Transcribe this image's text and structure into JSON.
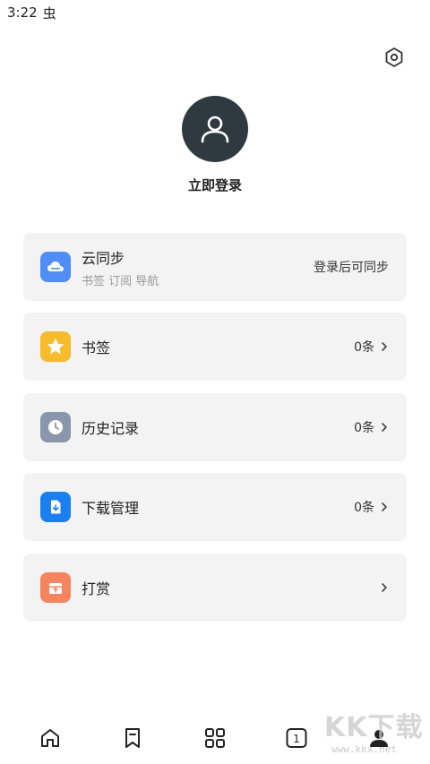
{
  "status_bar": {
    "time": "3:22",
    "bug_glyph": "虫"
  },
  "header": {
    "settings_icon": "hexagon-settings-icon"
  },
  "profile": {
    "avatar_icon": "user-icon",
    "login_label": "立即登录"
  },
  "cards": [
    {
      "title": "云同步",
      "subtitle": "书签 订阅 导航",
      "right_text": "登录后可同步",
      "icon": "cloud-icon",
      "color": "#4f8ef7",
      "chevron": false
    },
    {
      "title": "书签",
      "subtitle": "",
      "right_text": "0条",
      "icon": "star-icon",
      "color": "#f8bb2a",
      "chevron": true
    },
    {
      "title": "历史记录",
      "subtitle": "",
      "right_text": "0条",
      "icon": "clock-icon",
      "color": "#8a96ab",
      "chevron": true
    },
    {
      "title": "下载管理",
      "subtitle": "",
      "right_text": "0条",
      "icon": "download-icon",
      "color": "#1a7ff0",
      "chevron": true
    },
    {
      "title": "打赏",
      "subtitle": "",
      "right_text": "",
      "icon": "gift-icon",
      "color": "#f6845f",
      "chevron": true
    }
  ],
  "bottom_nav": {
    "items": [
      "home-icon",
      "bookmark-icon",
      "grid-icon",
      "tabs-icon",
      "profile-icon"
    ],
    "tab_count": "1"
  },
  "watermark": {
    "logo": "KK下载",
    "url": "www.kkx.net"
  }
}
